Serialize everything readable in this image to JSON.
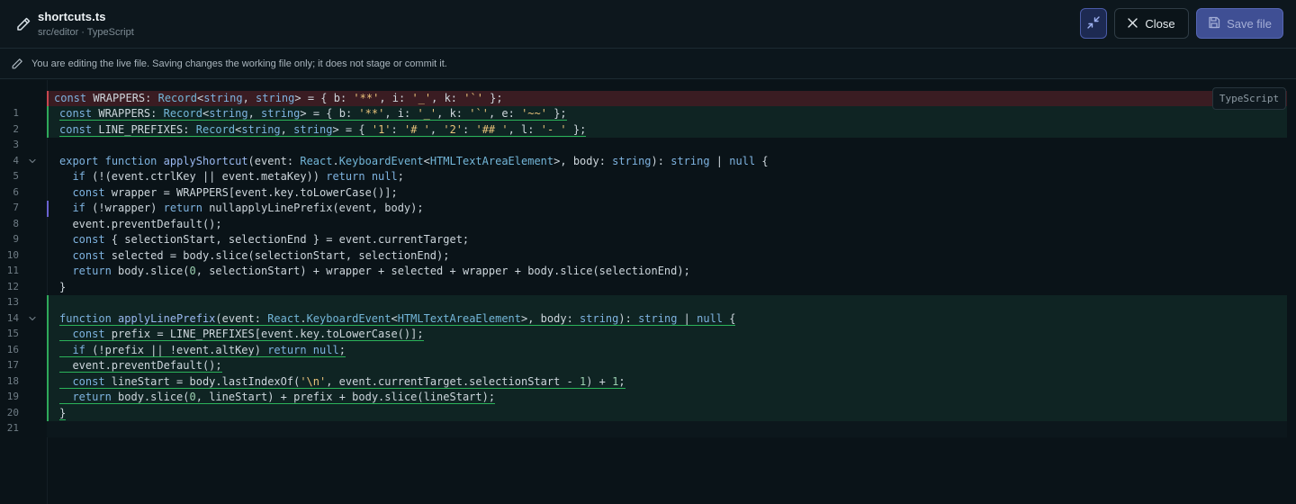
{
  "header": {
    "title": "shortcuts.ts",
    "subtitle": "src/editor · TypeScript",
    "close_label": "Close",
    "save_label": "Save file"
  },
  "notice": {
    "text": "You are editing the live file. Saving changes the working file only; it does not stage or commit it."
  },
  "editor": {
    "language_badge": "TypeScript",
    "colors": {
      "removed": "#3a1c22",
      "added": "#0f2423",
      "added_bar": "#2fa85a",
      "removed_bar": "#c7464f",
      "modified_bar": "#6a62d0"
    },
    "lines": [
      {
        "number": "",
        "status": "removed",
        "text": "const WRAPPERS: Record<string, string> = { b: '**', i: '_', k: '`' };"
      },
      {
        "number": "1",
        "status": "added",
        "text": "const WRAPPERS: Record<string, string> = { b: '**', i: '_', k: '`', e: '~~' };"
      },
      {
        "number": "2",
        "status": "added",
        "text": "const LINE_PREFIXES: Record<string, string> = { '1': '# ', '2': '## ', l: '- ' };"
      },
      {
        "number": "3",
        "status": "",
        "text": ""
      },
      {
        "number": "4",
        "status": "",
        "text": "export function applyShortcut(event: React.KeyboardEvent<HTMLTextAreaElement>, body: string): string | null {"
      },
      {
        "number": "5",
        "status": "",
        "text": "  if (!(event.ctrlKey || event.metaKey)) return null;"
      },
      {
        "number": "6",
        "status": "",
        "text": "  const wrapper = WRAPPERS[event.key.toLowerCase()];"
      },
      {
        "number": "7",
        "status": "modified",
        "text": "  if (!wrapper) return nullapplyLinePrefix(event, body);"
      },
      {
        "number": "8",
        "status": "",
        "text": "  event.preventDefault();"
      },
      {
        "number": "9",
        "status": "",
        "text": "  const { selectionStart, selectionEnd } = event.currentTarget;"
      },
      {
        "number": "10",
        "status": "",
        "text": "  const selected = body.slice(selectionStart, selectionEnd);"
      },
      {
        "number": "11",
        "status": "",
        "text": "  return body.slice(0, selectionStart) + wrapper + selected + wrapper + body.slice(selectionEnd);"
      },
      {
        "number": "12",
        "status": "",
        "text": "}"
      },
      {
        "number": "13",
        "status": "added",
        "text": ""
      },
      {
        "number": "14",
        "status": "added",
        "text": "function applyLinePrefix(event: React.KeyboardEvent<HTMLTextAreaElement>, body: string): string | null {"
      },
      {
        "number": "15",
        "status": "added",
        "text": "  const prefix = LINE_PREFIXES[event.key.toLowerCase()];"
      },
      {
        "number": "16",
        "status": "added",
        "text": "  if (!prefix || !event.altKey) return null;"
      },
      {
        "number": "17",
        "status": "added",
        "text": "  event.preventDefault();"
      },
      {
        "number": "18",
        "status": "added",
        "text": "  const lineStart = body.lastIndexOf('\\n', event.currentTarget.selectionStart - 1) + 1;"
      },
      {
        "number": "19",
        "status": "added",
        "text": "  return body.slice(0, lineStart) + prefix + body.slice(lineStart);"
      },
      {
        "number": "20",
        "status": "added",
        "text": "}"
      },
      {
        "number": "21",
        "status": "",
        "text": ""
      }
    ]
  }
}
